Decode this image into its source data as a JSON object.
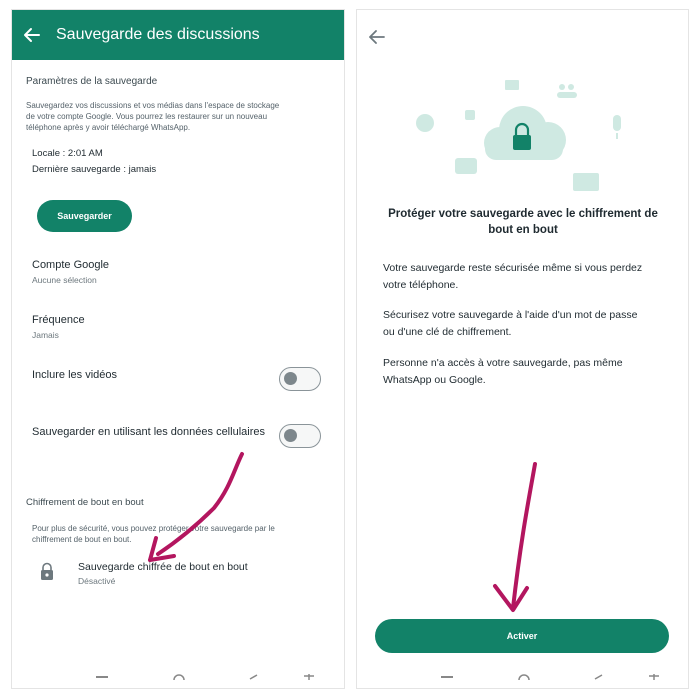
{
  "left": {
    "header": {
      "title": "Sauvegarde des discussions",
      "back_icon": "arrow-left-icon"
    },
    "backup_settings": {
      "title": "Paramètres de la sauvegarde",
      "desc_lines": [
        "Sauvegardez vos discussions et vos médias dans l'espace de stockage",
        "de votre compte Google. Vous pourrez les restaurer sur un nouveau",
        "téléphone après y avoir téléchargé WhatsApp."
      ],
      "local": "Locale : 2:01 AM",
      "last_backup": "Dernière sauvegarde : jamais",
      "save_button": "Sauvegarder"
    },
    "google_account": {
      "label": "Compte Google",
      "value": "Aucune sélection"
    },
    "frequency": {
      "label": "Fréquence",
      "value": "Jamais"
    },
    "include_videos": {
      "label": "Inclure les vidéos",
      "enabled": false
    },
    "cellular": {
      "label": "Sauvegarder en utilisant les données cellulaires",
      "enabled": false
    },
    "e2e": {
      "title": "Chiffrement de bout en bout",
      "desc_lines": [
        "Pour plus de sécurité, vous pouvez protéger votre sauvegarde par le",
        "chiffrement de bout en bout."
      ],
      "item_label": "Sauvegarde chiffrée de bout en bout",
      "item_status": "Désactivé"
    }
  },
  "right": {
    "back_icon": "arrow-left-icon",
    "heading_lines": [
      "Protéger votre sauvegarde avec le chiffrement de",
      "bout en bout"
    ],
    "paragraphs": [
      [
        "Votre sauvegarde reste sécurisée même si vous perdez",
        "votre téléphone."
      ],
      [
        "Sécurisez votre sauvegarde à l'aide d'un mot de passe",
        "ou d'une clé de chiffrement."
      ],
      [
        "Personne n'a accès à votre sauvegarde, pas même",
        "WhatsApp ou Google."
      ]
    ],
    "activate_button": "Activer"
  },
  "colors": {
    "brand": "#128268",
    "arrow": "#b3165f",
    "illustration": "#cfe9e2"
  }
}
